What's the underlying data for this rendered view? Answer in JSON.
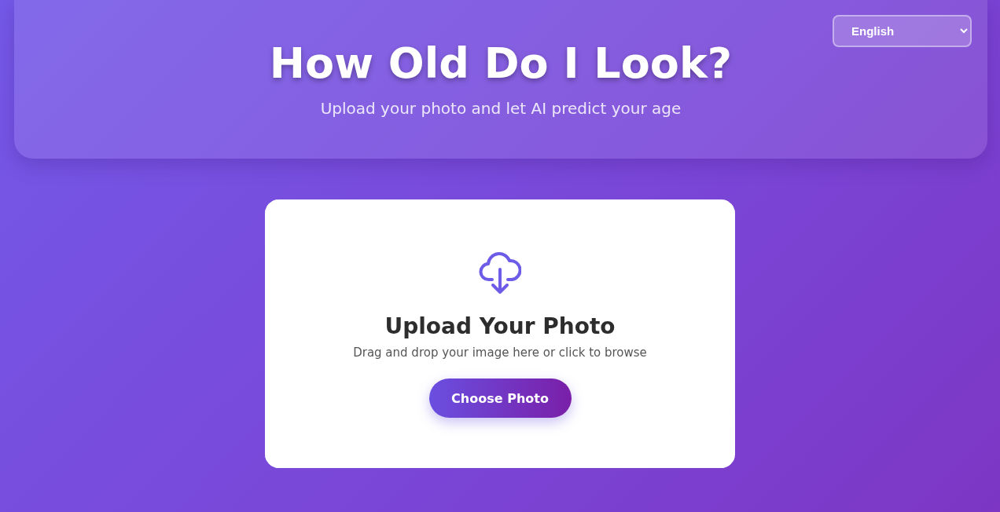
{
  "header": {
    "title": "How Old Do I Look?",
    "subtitle": "Upload your photo and let AI predict your age"
  },
  "language_select": {
    "value": "English"
  },
  "upload": {
    "title": "Upload Your Photo",
    "hint": "Drag and drop your image here or click to browse",
    "button": "Choose Photo"
  }
}
